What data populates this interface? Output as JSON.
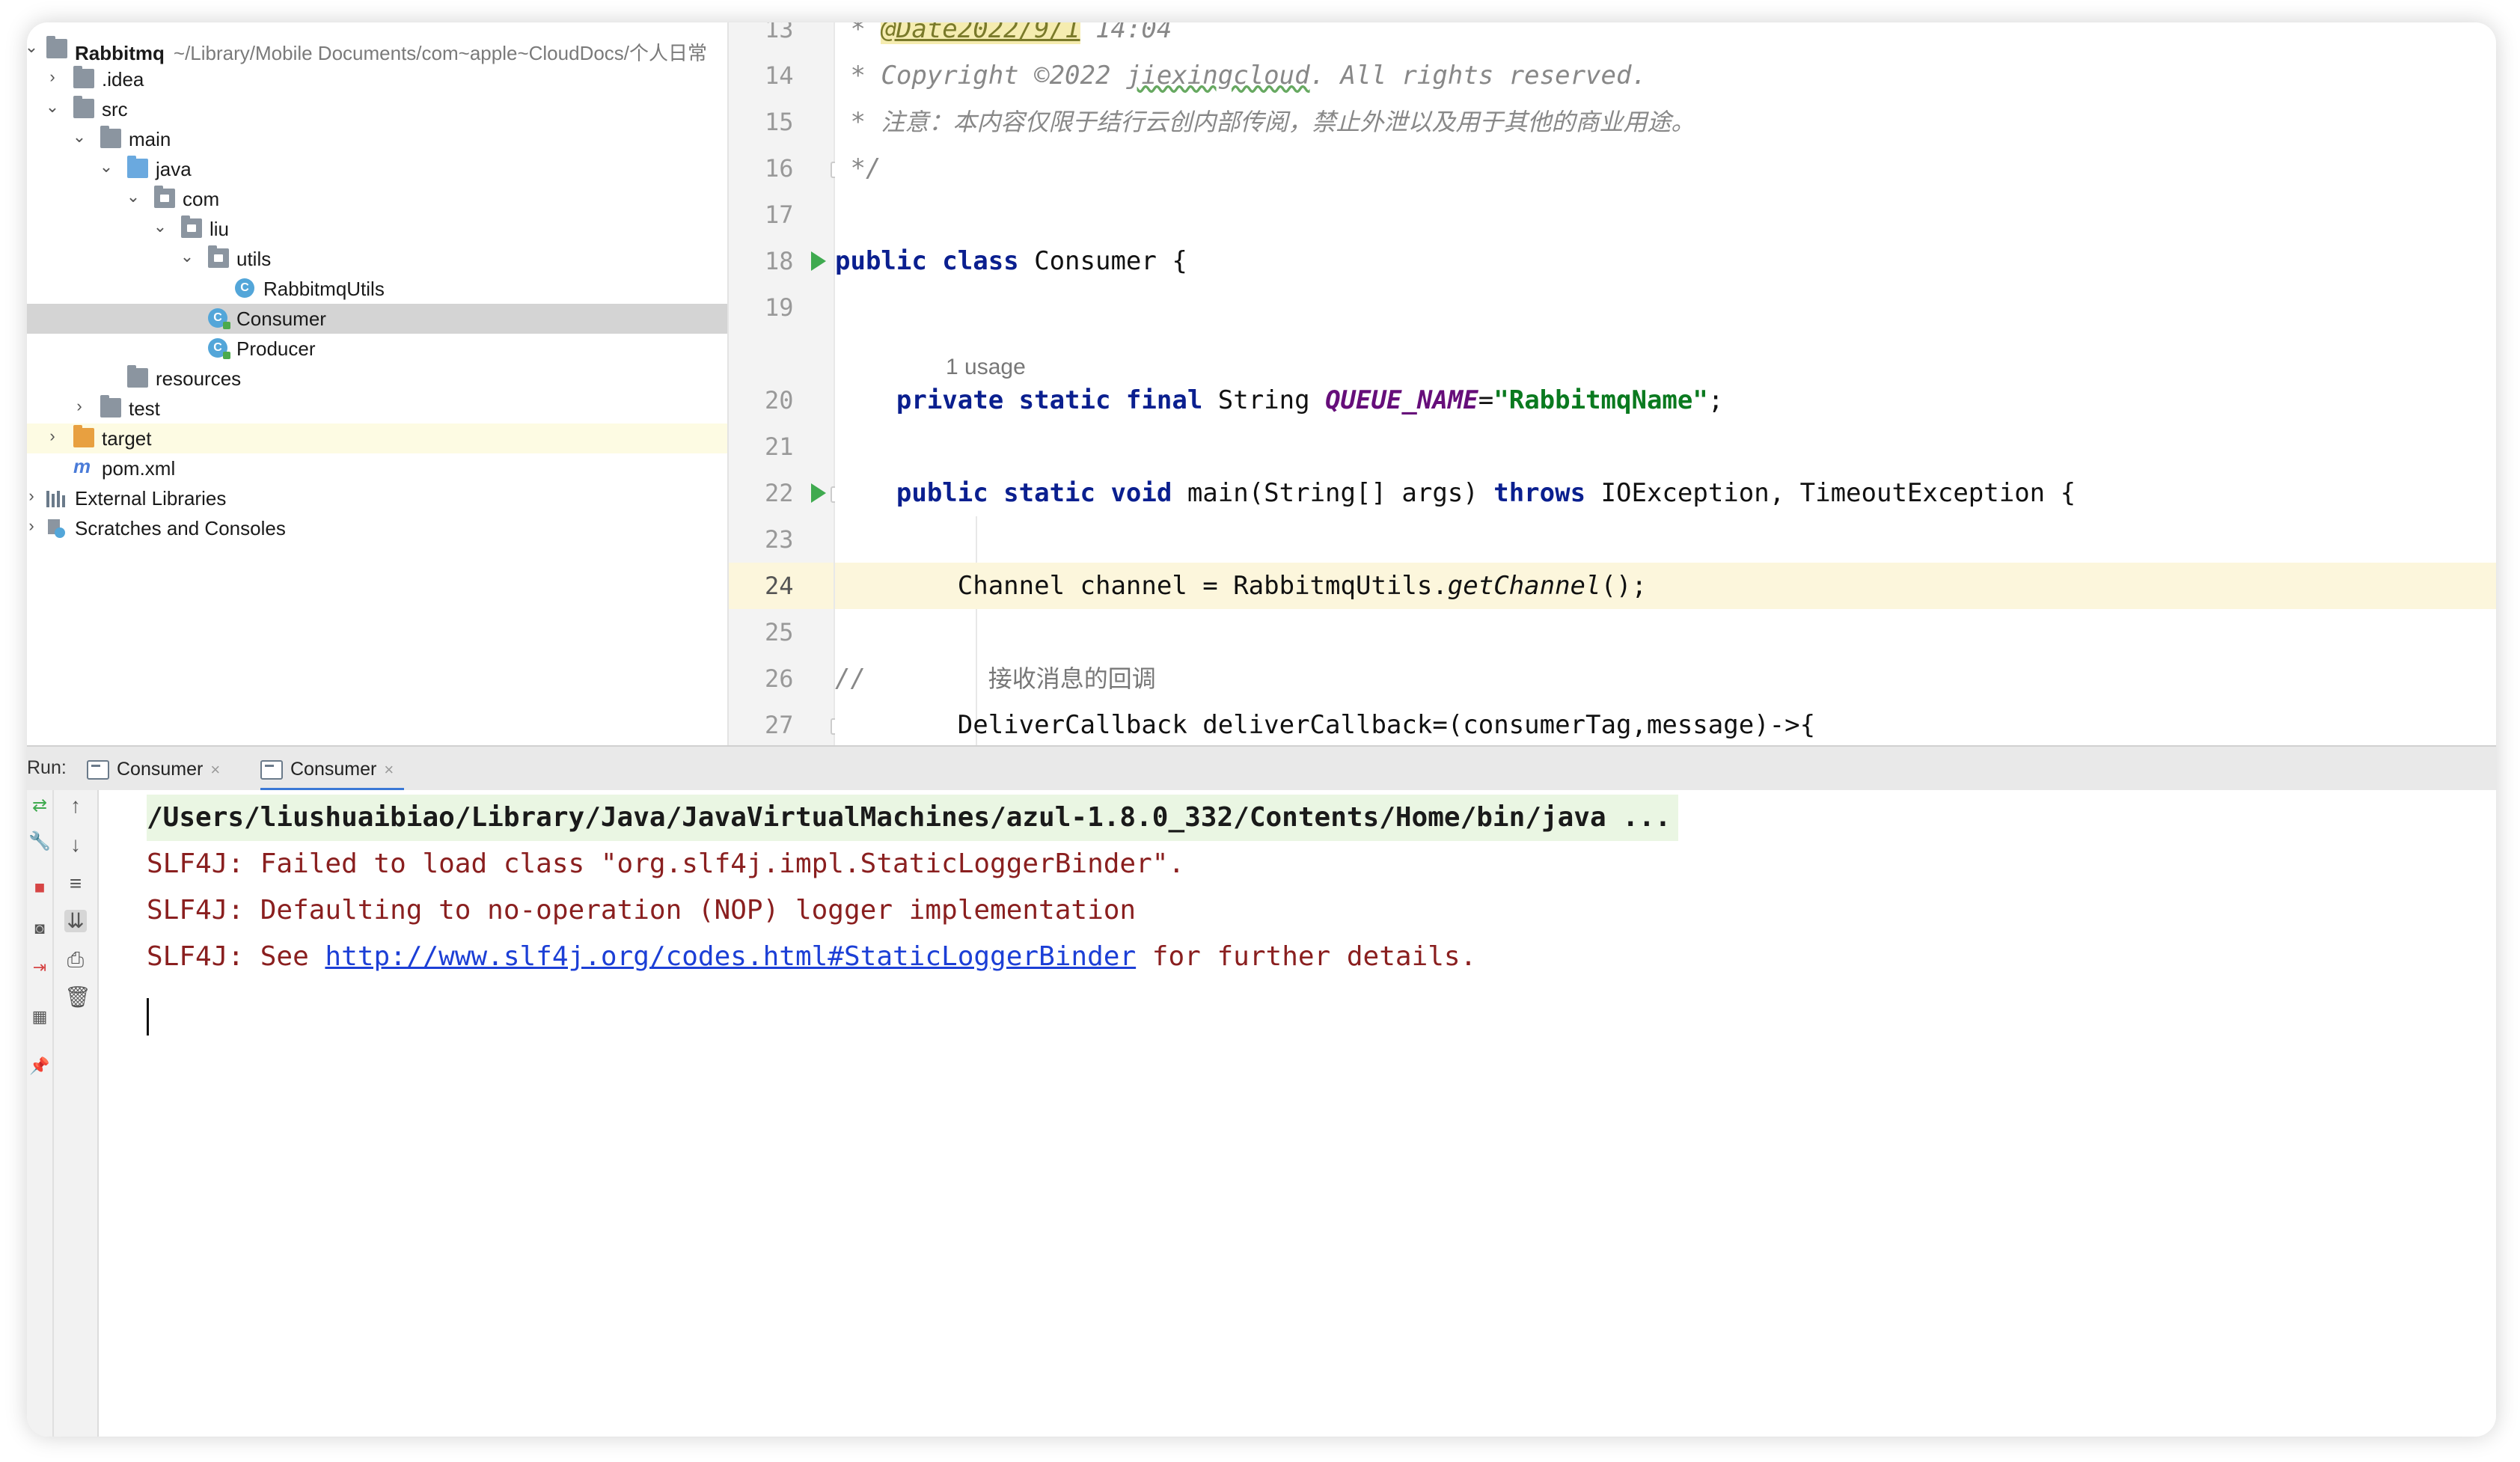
{
  "project": {
    "root_name": "Rabbitmq",
    "root_path": "~/Library/Mobile Documents/com~apple~CloudDocs/个人日常",
    "items": [
      {
        "label": "Rabbitmq"
      },
      {
        "label": ".idea"
      },
      {
        "label": "src"
      },
      {
        "label": "main"
      },
      {
        "label": "java"
      },
      {
        "label": "com"
      },
      {
        "label": "liu"
      },
      {
        "label": "utils"
      },
      {
        "label": "RabbitmqUtils"
      },
      {
        "label": "Consumer"
      },
      {
        "label": "Producer"
      },
      {
        "label": "resources"
      },
      {
        "label": "test"
      },
      {
        "label": "target"
      },
      {
        "label": "pom.xml"
      },
      {
        "label": "External Libraries"
      },
      {
        "label": "Scratches and Consoles"
      }
    ]
  },
  "editor": {
    "line_numbers": [
      "13",
      "14",
      "15",
      "16",
      "17",
      "18",
      "19",
      "20",
      "21",
      "22",
      "23",
      "24",
      "25",
      "26",
      "27"
    ],
    "usage_hint": "1 usage",
    "code": {
      "l13_star": " * ",
      "l13_tag": "@Date2022/9/1",
      "l13_time": " 14:04",
      "l14_a": " * Copyright ©2022 ",
      "l14_b": "jiexingcloud",
      "l14_c": ". All rights reserved.",
      "l15_a": " * ",
      "l15_b": "注意：本内容仅限于结行云创内部传阅，禁止外泄以及用于其他的商业用途。",
      "l16": " */",
      "l18_kw": "public class",
      "l18_rest": " Consumer {",
      "l20_indent": "    ",
      "l20_kw": "private static final",
      "l20_type": " String ",
      "l20_const": "QUEUE_NAME",
      "l20_eq": "=",
      "l20_str": "\"RabbitmqName\"",
      "l20_end": ";",
      "l22_indent": "    ",
      "l22_kw": "public static void",
      "l22_mid": " main(String[] args) ",
      "l22_throws": "throws",
      "l22_rest": " IOException, TimeoutException {",
      "l24_a": "        Channel channel = RabbitmqUtils.",
      "l24_b": "getChannel",
      "l24_c": "();",
      "l26_a": "//        ",
      "l26_b": "接收消息的回调",
      "l27": "        DeliverCallback deliverCallback=(consumerTag,message)->{"
    }
  },
  "run": {
    "label": "Run:",
    "tabs": [
      {
        "label": "Consumer"
      },
      {
        "label": "Consumer"
      }
    ],
    "close_glyph": "×"
  },
  "console": {
    "command": "/Users/liushuaibiao/Library/Java/JavaVirtualMachines/azul-1.8.0_332/Contents/Home/bin/java ...",
    "line1": "SLF4J: Failed to load class \"org.slf4j.impl.StaticLoggerBinder\".",
    "line2": "SLF4J: Defaulting to no-operation (NOP) logger implementation",
    "line3_a": "SLF4J: See ",
    "line3_link": "http://www.slf4j.org/codes.html#StaticLoggerBinder",
    "line3_b": " for further details."
  }
}
